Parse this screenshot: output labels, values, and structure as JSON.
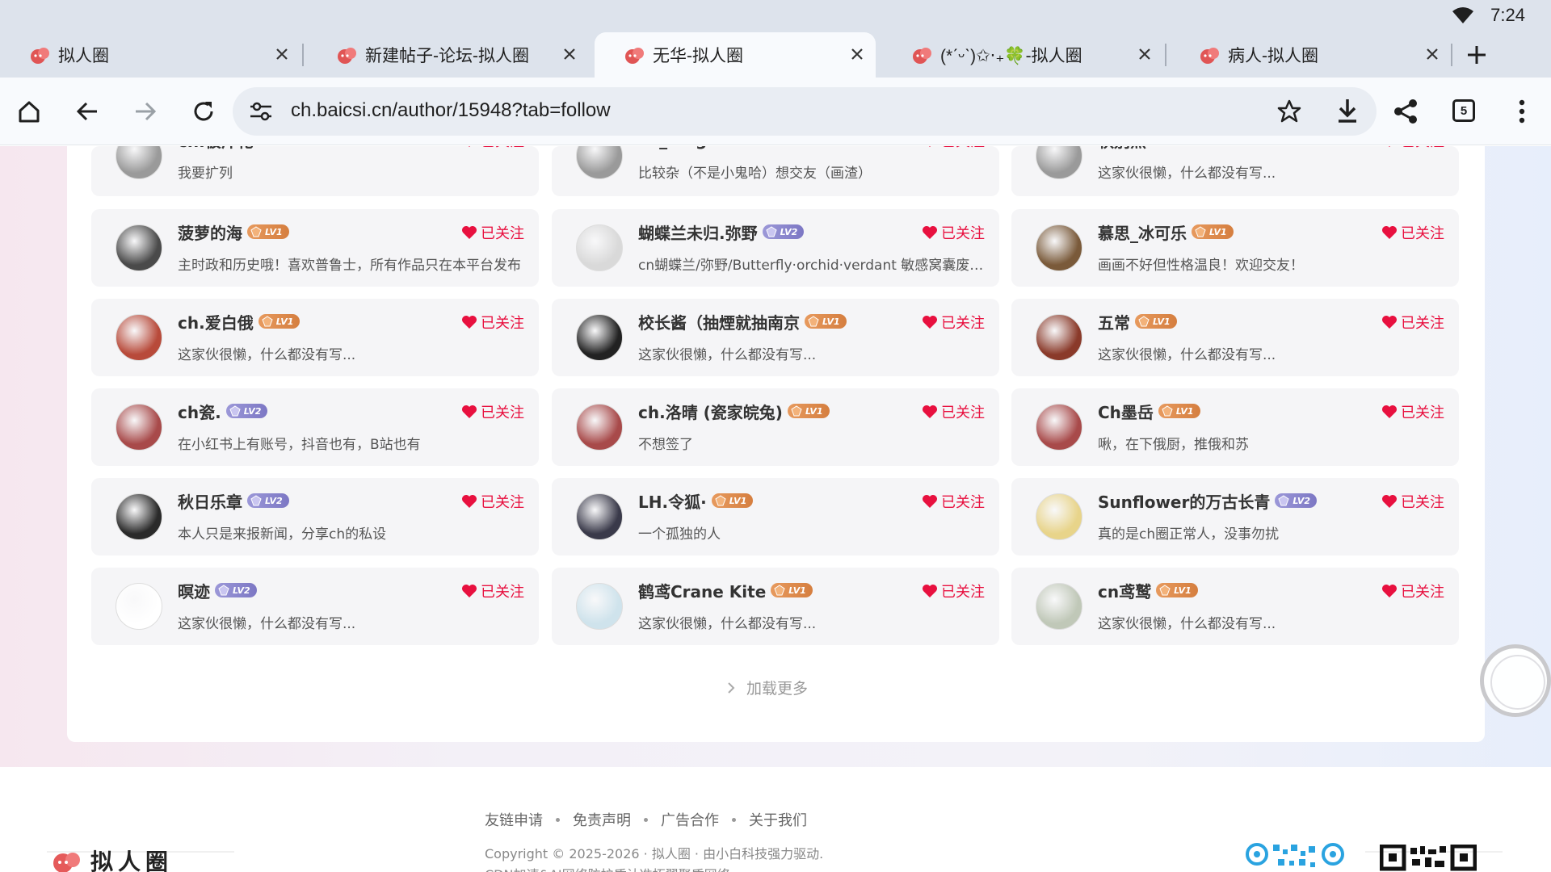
{
  "status": {
    "time": "7:24"
  },
  "tabs": [
    {
      "title": "拟人圈",
      "active": false
    },
    {
      "title": "新建帖子-论坛-拟人圈",
      "active": false
    },
    {
      "title": "无华-拟人圈",
      "active": true
    },
    {
      "title": "(*ˊᵕˋ)✩︎‧₊🍀-拟人圈",
      "active": false
    },
    {
      "title": "病人-拟人圈",
      "active": false
    }
  ],
  "toolbar": {
    "url": "ch.baicsi.cn/author/15948?tab=follow",
    "tab_count": "5"
  },
  "follow_label": "已关注",
  "partial_row": [
    {
      "name": "ch.被斤花",
      "desc": "我要扩列"
    },
    {
      "name": "ch_long",
      "desc": "比较杂（不是小鬼哈）想交友（画渣）"
    },
    {
      "name": "秋别熬",
      "desc": "这家伙很懒，什么都没有写..."
    }
  ],
  "users": [
    {
      "name": "菠萝的海",
      "level": "LV1",
      "desc": "主时政和历史哦！喜欢普鲁士，所有作品只在本平台发布",
      "avatar_color": "#4a4a4a"
    },
    {
      "name": "蝴蝶兰未归.弥野",
      "level": "LV2",
      "desc": "cn蝴蝶兰/弥野/Butterfly·orchid·verdant 敏感窝囊废一枚",
      "avatar_color": "#d9d9d9"
    },
    {
      "name": "慕思_冰可乐",
      "level": "LV1",
      "desc": "画画不好但性格温良！欢迎交友！",
      "avatar_color": "#7a5a3a"
    },
    {
      "name": "ch.爱白俄",
      "level": "LV1",
      "desc": "这家伙很懒，什么都没有写...",
      "avatar_color": "#b84a3a"
    },
    {
      "name": "校长酱（抽煙就抽南京",
      "level": "LV1",
      "desc": "这家伙很懒，什么都没有写...",
      "avatar_color": "#222222"
    },
    {
      "name": "五常",
      "level": "LV1",
      "desc": "这家伙很懒，什么都没有写...",
      "avatar_color": "#8a3a2a"
    },
    {
      "name": "ch瓷.",
      "level": "LV2",
      "desc": "在小红书上有账号，抖音也有，B站也有",
      "avatar_color": "#a84a4a"
    },
    {
      "name": "ch.洛晴 (瓷家皖兔)",
      "level": "LV1",
      "desc": "不想签了",
      "avatar_color": "#a84a4a"
    },
    {
      "name": "Ch墨岳",
      "level": "LV1",
      "desc": "啾，在下俄厨，推俄和苏",
      "avatar_color": "#a84a4a"
    },
    {
      "name": "秋日乐章",
      "level": "LV2",
      "desc": "本人只是来报新闻，分享ch的私设",
      "avatar_color": "#2a2a2a"
    },
    {
      "name": "LH.令狐·",
      "level": "LV1",
      "desc": "一个孤独的人",
      "avatar_color": "#3a3a4a"
    },
    {
      "name": "Sunflower的万古长青",
      "level": "LV2",
      "desc": "真的是ch圈正常人，没事勿扰",
      "avatar_color": "#e8d48a"
    },
    {
      "name": "暝迹",
      "level": "LV2",
      "desc": "这家伙很懒，什么都没有写...",
      "avatar_color": "#ffffff"
    },
    {
      "name": "鹤鸢Crane Kite",
      "level": "LV1",
      "desc": "这家伙很懒，什么都没有写...",
      "avatar_color": "#cfe3ec"
    },
    {
      "name": "cn鸢鹫",
      "level": "LV1",
      "desc": "这家伙很懒，什么都没有写...",
      "avatar_color": "#c0c8b8"
    }
  ],
  "load_more": "加载更多",
  "footer": {
    "links": [
      "友链申请",
      "免责声明",
      "广告合作",
      "关于我们"
    ],
    "copyright": "Copyright © 2025-2026 · 拟人圈 · 由小白科技强力驱动.",
    "cdn": "CDN加速&AI网络防护盾认准拓翼聚盾网络",
    "logo_text": "拟人圈"
  },
  "colors": {
    "follow": "#e8103f",
    "lv1": "#d98a4a",
    "lv2": "#8a85cc"
  }
}
